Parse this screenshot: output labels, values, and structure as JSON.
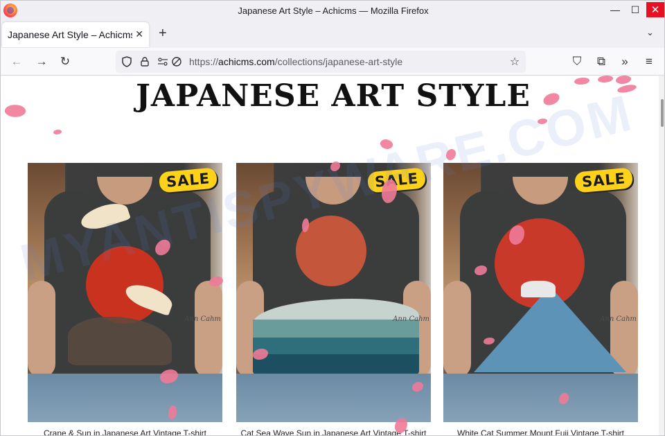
{
  "window": {
    "title": "Japanese Art Style – Achicms — Mozilla Firefox",
    "minimize": "—",
    "maximize": "☐",
    "close": "✕"
  },
  "tabs": [
    {
      "title": "Japanese Art Style – Achicms",
      "close": "✕"
    }
  ],
  "tabstrip": {
    "new_tab": "+",
    "list_all": "⌄"
  },
  "nav": {
    "back": "←",
    "forward": "→",
    "reload": "↻",
    "url_scheme": "https://",
    "url_domain": "achicms.com",
    "url_path": "/collections/japanese-art-style",
    "bookmark": "☆",
    "pocket": "⛉",
    "extensions": "⧉",
    "overflow": "»",
    "menu": "≡"
  },
  "page": {
    "title": "JAPANESE ART STYLE",
    "watermark": "MYANTISPYWARE.COM"
  },
  "products": [
    {
      "badge": "SALE",
      "tattoo": "Ann Cahm",
      "caption": "Crane & Sun in Japanese Art Vintage T-shirt"
    },
    {
      "badge": "SALE",
      "tattoo": "Ann Cahm",
      "caption": "Cat Sea Wave Sun in Japanese Art Vintage T-shirt"
    },
    {
      "badge": "SALE",
      "tattoo": "Ann Cahm",
      "caption": "White Cat Summer Mount Fuji Vintage T-shirt"
    }
  ],
  "colors": {
    "accent_petal": "#f07a98",
    "sale_badge": "#ffd21a",
    "close_button": "#e81123"
  },
  "icons": {
    "firefox_logo": "firefox-icon",
    "shield": "tracking-shield-icon",
    "lock": "lock-icon",
    "permissions": "permissions-icon",
    "tracking": "tracking-blocked-icon"
  }
}
